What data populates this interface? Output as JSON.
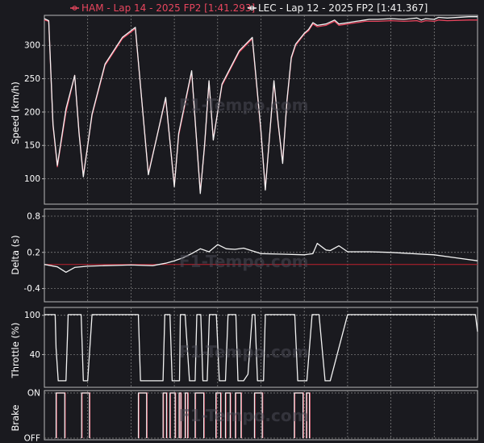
{
  "legend": {
    "series_a": "HAM - Lap 14 - 2025 FP2 [1:41.293]",
    "series_b": "LEC - Lap 12 - 2025 FP2 [1:41.367]"
  },
  "watermark": "F1-Tempo.com",
  "colors": {
    "ham": "#e8465e",
    "lec": "#f2f2f2",
    "background": "#1a1a1f",
    "zero_line": "#c0202e"
  },
  "chart_data": [
    {
      "type": "line",
      "title": "",
      "xlabel": "",
      "ylabel": "Speed (km/h)",
      "ylim": [
        62,
        345
      ],
      "yticks": [
        100,
        150,
        200,
        250,
        300
      ],
      "x": [
        0,
        1,
        2,
        3,
        5,
        7,
        8,
        9,
        11,
        14,
        18,
        21,
        24,
        28,
        30,
        31,
        34,
        36,
        37,
        38,
        39,
        41,
        45,
        48,
        50,
        51,
        53,
        54,
        55,
        56,
        57,
        58,
        60,
        61,
        62,
        63,
        65,
        66,
        67,
        68,
        70,
        72,
        73,
        74,
        75,
        77,
        80,
        83,
        86,
        87,
        88,
        90,
        91,
        93,
        98,
        100
      ],
      "series": [
        {
          "name": "HAM",
          "values": [
            338,
            336,
            180,
            118,
            200,
            255,
            170,
            105,
            195,
            270,
            310,
            325,
            108,
            220,
            90,
            165,
            260,
            80,
            150,
            245,
            160,
            240,
            290,
            310,
            170,
            85,
            245,
            180,
            125,
            215,
            280,
            300,
            317,
            322,
            332,
            328,
            330,
            333,
            336,
            330,
            332,
            334,
            335,
            336,
            336,
            336,
            337,
            336,
            337,
            335,
            337,
            336,
            338,
            337,
            338,
            338
          ]
        },
        {
          "name": "LEC",
          "values": [
            340,
            337,
            182,
            120,
            205,
            255,
            168,
            103,
            197,
            272,
            312,
            327,
            106,
            222,
            88,
            168,
            262,
            78,
            152,
            247,
            158,
            242,
            292,
            312,
            172,
            83,
            247,
            182,
            123,
            217,
            282,
            302,
            318,
            324,
            334,
            330,
            332,
            335,
            338,
            332,
            334,
            336,
            337,
            338,
            339,
            339,
            340,
            339,
            341,
            338,
            340,
            339,
            342,
            341,
            343,
            343
          ]
        }
      ]
    },
    {
      "type": "line",
      "title": "",
      "xlabel": "",
      "ylabel": "Delta (s)",
      "ylim": [
        -0.62,
        0.92
      ],
      "yticks": [
        -0.4,
        0.2,
        0.8
      ],
      "reference_line": 0,
      "x": [
        0,
        3,
        5,
        7,
        10,
        14,
        20,
        25,
        28,
        30,
        32,
        34,
        36,
        38,
        40,
        42,
        44,
        46,
        50,
        55,
        60,
        62,
        63,
        65,
        66,
        68,
        70,
        75,
        80,
        85,
        90,
        95,
        100
      ],
      "series": [
        {
          "name": "LEC",
          "values": [
            0.0,
            -0.04,
            -0.13,
            -0.05,
            -0.03,
            -0.02,
            -0.01,
            -0.02,
            0.02,
            0.06,
            0.11,
            0.18,
            0.26,
            0.21,
            0.33,
            0.26,
            0.25,
            0.27,
            0.18,
            0.17,
            0.16,
            0.18,
            0.35,
            0.24,
            0.23,
            0.31,
            0.21,
            0.21,
            0.2,
            0.18,
            0.16,
            0.11,
            0.06
          ]
        }
      ]
    },
    {
      "type": "line",
      "title": "",
      "xlabel": "",
      "ylabel": "Throttle (%)",
      "ylim": [
        -10,
        112
      ],
      "yticks": [
        40,
        100
      ],
      "x": [
        0,
        2.5,
        2.7,
        3.2,
        5,
        5.5,
        8.5,
        9,
        10,
        11,
        21.7,
        22.2,
        27.4,
        27.8,
        29,
        29.5,
        31.2,
        31.4,
        32.5,
        33.5,
        34.8,
        35.2,
        36.1,
        36.6,
        37.6,
        38.1,
        39.7,
        40.4,
        41.8,
        42.4,
        44.2,
        44.7,
        46,
        47,
        48,
        48.6,
        49.2,
        50.6,
        51,
        53,
        57.8,
        58.5,
        60.6,
        61.8,
        63.4,
        64.8,
        66,
        70,
        90,
        99.5,
        100
      ],
      "series": [
        {
          "name": "LEC",
          "values": [
            101,
            101,
            50,
            0,
            0,
            101,
            101,
            0,
            0,
            101,
            101,
            0,
            0,
            101,
            101,
            0,
            0,
            101,
            101,
            0,
            0,
            101,
            101,
            0,
            0,
            101,
            101,
            0,
            0,
            101,
            101,
            0,
            0,
            10,
            101,
            101,
            0,
            0,
            101,
            101,
            101,
            0,
            0,
            101,
            101,
            0,
            0,
            101,
            101,
            101,
            75
          ]
        }
      ]
    },
    {
      "type": "line",
      "title": "",
      "xlabel": "",
      "ylabel": "Brake",
      "yticks_labels": [
        "OFF",
        "ON"
      ],
      "ylim": [
        0,
        1
      ],
      "brake_zones": [
        {
          "start": 2.7,
          "end": 4.7
        },
        {
          "start": 8.6,
          "end": 10.4
        },
        {
          "start": 21.7,
          "end": 23.6
        },
        {
          "start": 27.4,
          "end": 28.2
        },
        {
          "start": 29.0,
          "end": 30.2
        },
        {
          "start": 31.1,
          "end": 31.5
        },
        {
          "start": 32.5,
          "end": 33.1
        },
        {
          "start": 34.8,
          "end": 36.8
        },
        {
          "start": 39.6,
          "end": 40.7
        },
        {
          "start": 41.8,
          "end": 42.9
        },
        {
          "start": 44.1,
          "end": 45.4
        },
        {
          "start": 48.5,
          "end": 50.3
        },
        {
          "start": 57.7,
          "end": 59.7
        },
        {
          "start": 60.5,
          "end": 61.2
        }
      ]
    }
  ]
}
